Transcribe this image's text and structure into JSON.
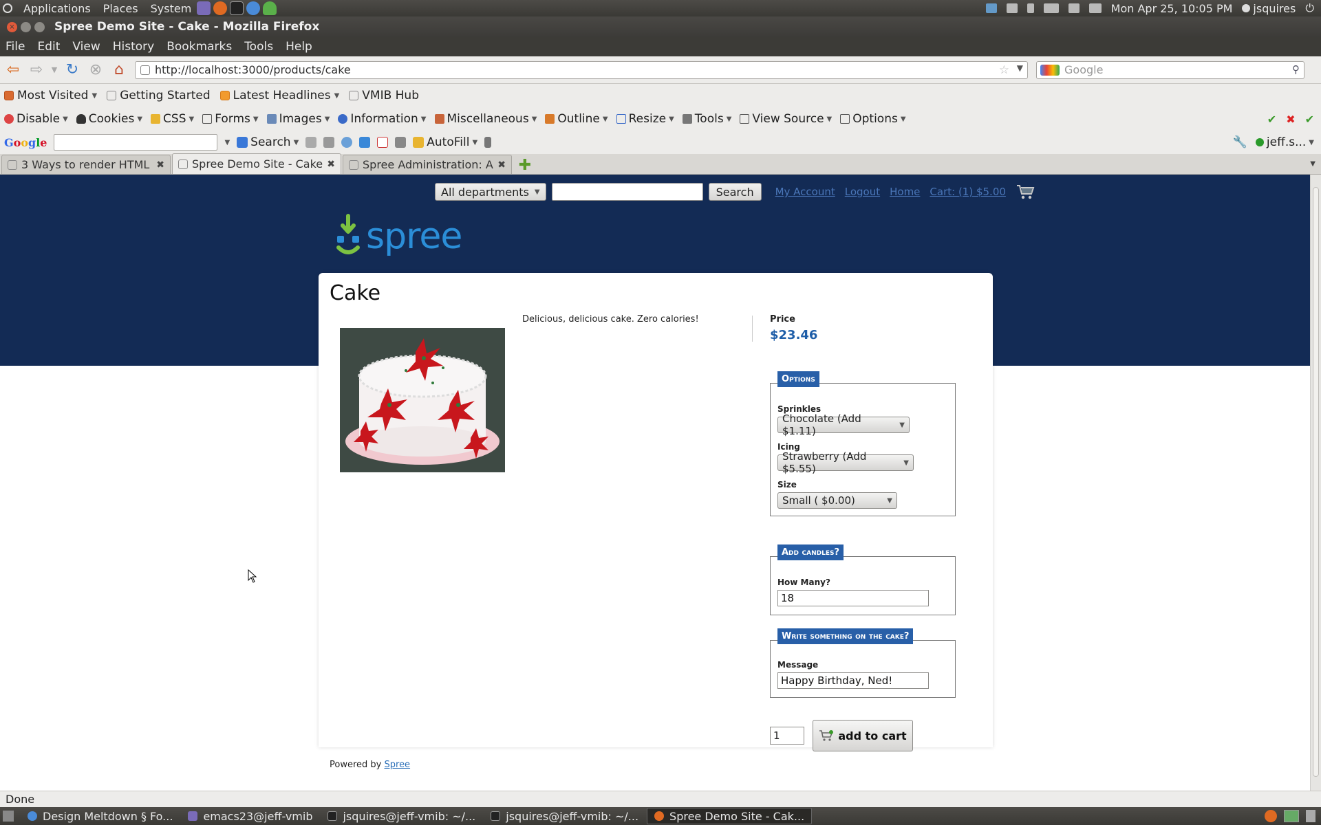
{
  "gnome": {
    "menus": [
      "Applications",
      "Places",
      "System"
    ],
    "clock": "Mon Apr 25, 10:05 PM",
    "user": "jsquires"
  },
  "window": {
    "title": "Spree Demo Site - Cake - Mozilla Firefox"
  },
  "menubar": [
    "File",
    "Edit",
    "View",
    "History",
    "Bookmarks",
    "Tools",
    "Help"
  ],
  "navbar": {
    "url": "http://localhost:3000/products/cake",
    "search_placeholder": "Google"
  },
  "bookmarks": [
    {
      "label": "Most Visited",
      "caret": true
    },
    {
      "label": "Getting Started",
      "caret": false
    },
    {
      "label": "Latest Headlines",
      "caret": true
    },
    {
      "label": "VMIB Hub",
      "caret": false
    }
  ],
  "webdev": [
    "Disable",
    "Cookies",
    "CSS",
    "Forms",
    "Images",
    "Information",
    "Miscellaneous",
    "Outline",
    "Resize",
    "Tools",
    "View Source",
    "Options"
  ],
  "googlebar": {
    "search_label": "Search",
    "autofill_label": "AutoFill",
    "account": "jeff.s..."
  },
  "tabs": [
    {
      "label": "3 Ways to render HTML ...",
      "active": false
    },
    {
      "label": "Spree Demo Site - Cake",
      "active": true
    },
    {
      "label": "Spree Administration: A...",
      "active": false
    }
  ],
  "store": {
    "department": "All departments",
    "search_button": "Search",
    "links": [
      "My Account",
      "Logout",
      "Home",
      "Cart: (1) $5.00"
    ],
    "logo_text": "spree"
  },
  "product": {
    "name": "Cake",
    "description": "Delicious, delicious cake. Zero calories!",
    "price_label": "Price",
    "price": "$23.46",
    "options_legend": "Options",
    "options": [
      {
        "label": "Sprinkles",
        "value": "Chocolate (Add $1.11)"
      },
      {
        "label": "Icing",
        "value": "Strawberry (Add $5.55)"
      },
      {
        "label": "Size",
        "value": "Small ( $0.00)"
      }
    ],
    "candles_legend": "Add candles?",
    "candles_label": "How Many?",
    "candles_value": "18",
    "message_legend": "Write something on the cake?",
    "message_label": "Message",
    "message_value": "Happy Birthday, Ned!",
    "quantity": "1",
    "add_to_cart": "add to cart"
  },
  "footer": {
    "powered_by": "Powered by",
    "link": "Spree"
  },
  "status": "Done",
  "taskbar": [
    {
      "label": "Design Meltdown § Fo...",
      "active": false
    },
    {
      "label": "emacs23@jeff-vmib",
      "active": false
    },
    {
      "label": "jsquires@jeff-vmib: ~/...",
      "active": false
    },
    {
      "label": "jsquires@jeff-vmib: ~/...",
      "active": false
    },
    {
      "label": "Spree Demo Site - Cak...",
      "active": true
    }
  ],
  "colors": {
    "hero": "#132b55",
    "legend": "#285fa8",
    "price": "#1f5ea8",
    "link": "#4a76b8"
  }
}
